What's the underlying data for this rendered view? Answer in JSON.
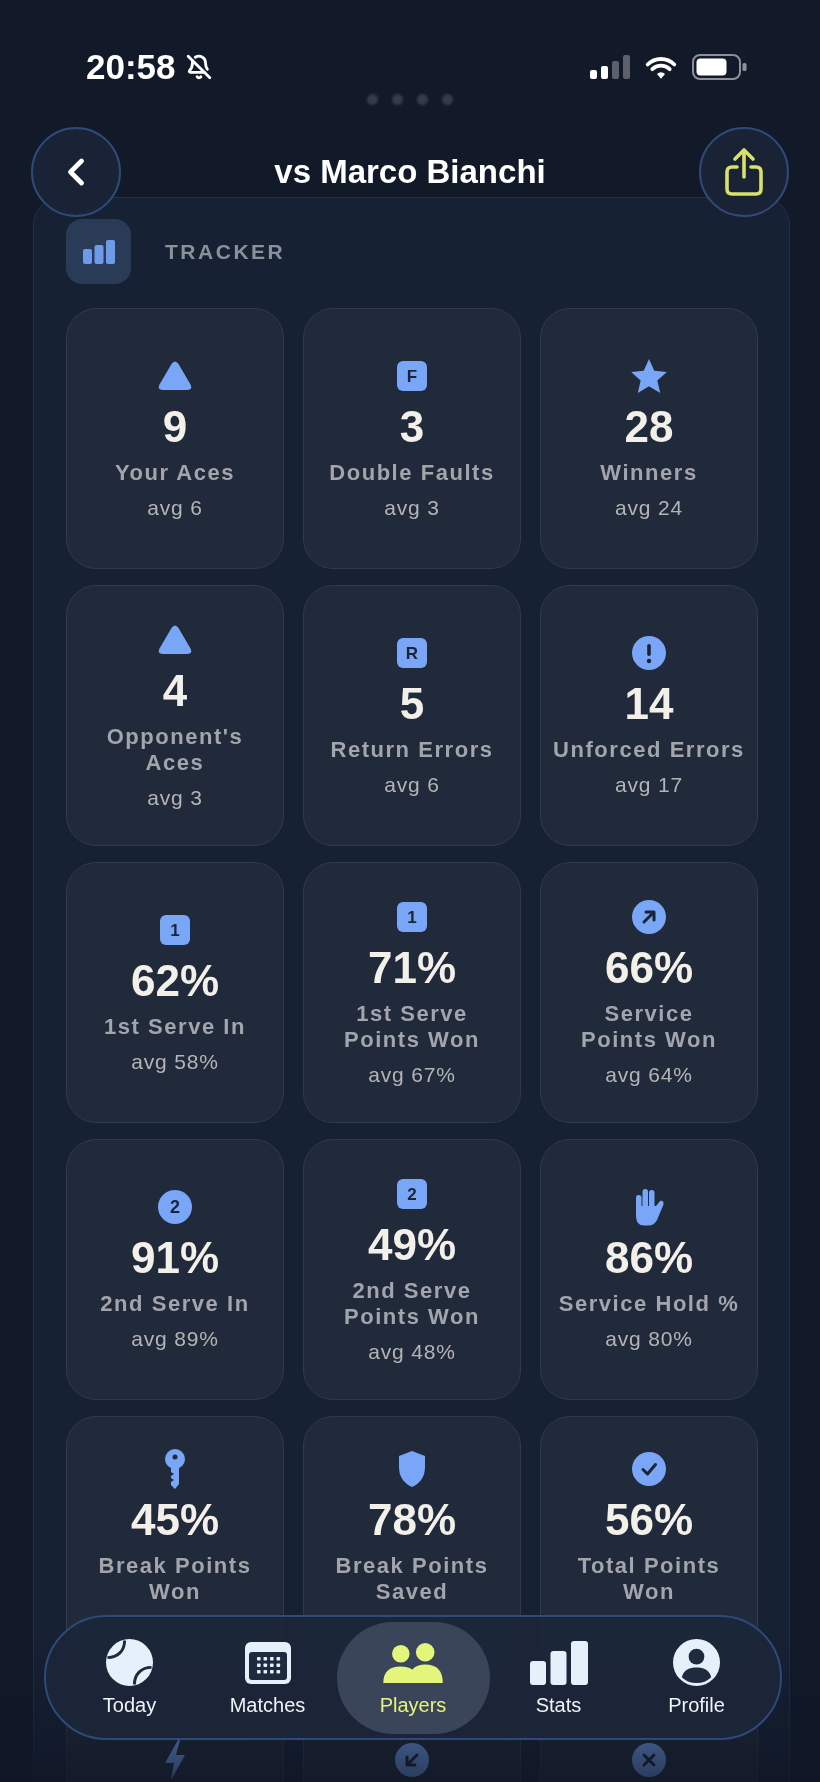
{
  "status_bar": {
    "time": "20:58"
  },
  "page_dots": [
    {
      "selected": false
    },
    {
      "selected": false
    },
    {
      "selected": false
    },
    {
      "selected": false
    }
  ],
  "header": {
    "title": "vs Marco Bianchi"
  },
  "tracker": {
    "title": "TRACKER",
    "stats": [
      {
        "kind": "triangle",
        "value": "9",
        "label": "Your Aces",
        "avg": "avg 6"
      },
      {
        "kind": "square",
        "badge": "F",
        "value": "3",
        "label": "Double Faults",
        "avg": "avg 3"
      },
      {
        "kind": "star",
        "value": "28",
        "label": "Winners",
        "avg": "avg 24"
      },
      {
        "kind": "triangle",
        "value": "4",
        "label": "Opponent's\nAces",
        "avg": "avg 3"
      },
      {
        "kind": "square",
        "badge": "R",
        "value": "5",
        "label": "Return Errors",
        "avg": "avg 6"
      },
      {
        "kind": "alert",
        "value": "14",
        "label": "Unforced Errors",
        "avg": "avg 17"
      },
      {
        "kind": "square",
        "badge": "1",
        "value": "62%",
        "label": "1st Serve In",
        "avg": "avg 58%"
      },
      {
        "kind": "square",
        "badge": "1",
        "value": "71%",
        "label": "1st Serve\nPoints Won",
        "avg": "avg 67%"
      },
      {
        "kind": "arrow",
        "value": "66%",
        "label": "Service\nPoints Won",
        "avg": "avg 64%"
      },
      {
        "kind": "circle",
        "badge": "2",
        "value": "91%",
        "label": "2nd Serve In",
        "avg": "avg 89%"
      },
      {
        "kind": "square",
        "badge": "2",
        "value": "49%",
        "label": "2nd Serve\nPoints Won",
        "avg": "avg 48%"
      },
      {
        "kind": "hand",
        "value": "86%",
        "label": "Service Hold %",
        "avg": "avg 80%"
      },
      {
        "kind": "key",
        "value": "45%",
        "label": "Break Points\nWon"
      },
      {
        "kind": "shield",
        "value": "78%",
        "label": "Break Points\nSaved"
      },
      {
        "kind": "check",
        "value": "56%",
        "label": "Total Points\nWon"
      },
      {
        "kind": "bolt"
      },
      {
        "kind": "inward"
      },
      {
        "kind": "cross"
      }
    ]
  },
  "nav": {
    "items": [
      {
        "kind": "ball",
        "label": "Today",
        "selected": false
      },
      {
        "kind": "calendar",
        "label": "Matches",
        "selected": false
      },
      {
        "kind": "people",
        "label": "Players",
        "selected": true
      },
      {
        "kind": "bars",
        "label": "Stats",
        "selected": false
      },
      {
        "kind": "person",
        "label": "Profile",
        "selected": false
      }
    ]
  }
}
